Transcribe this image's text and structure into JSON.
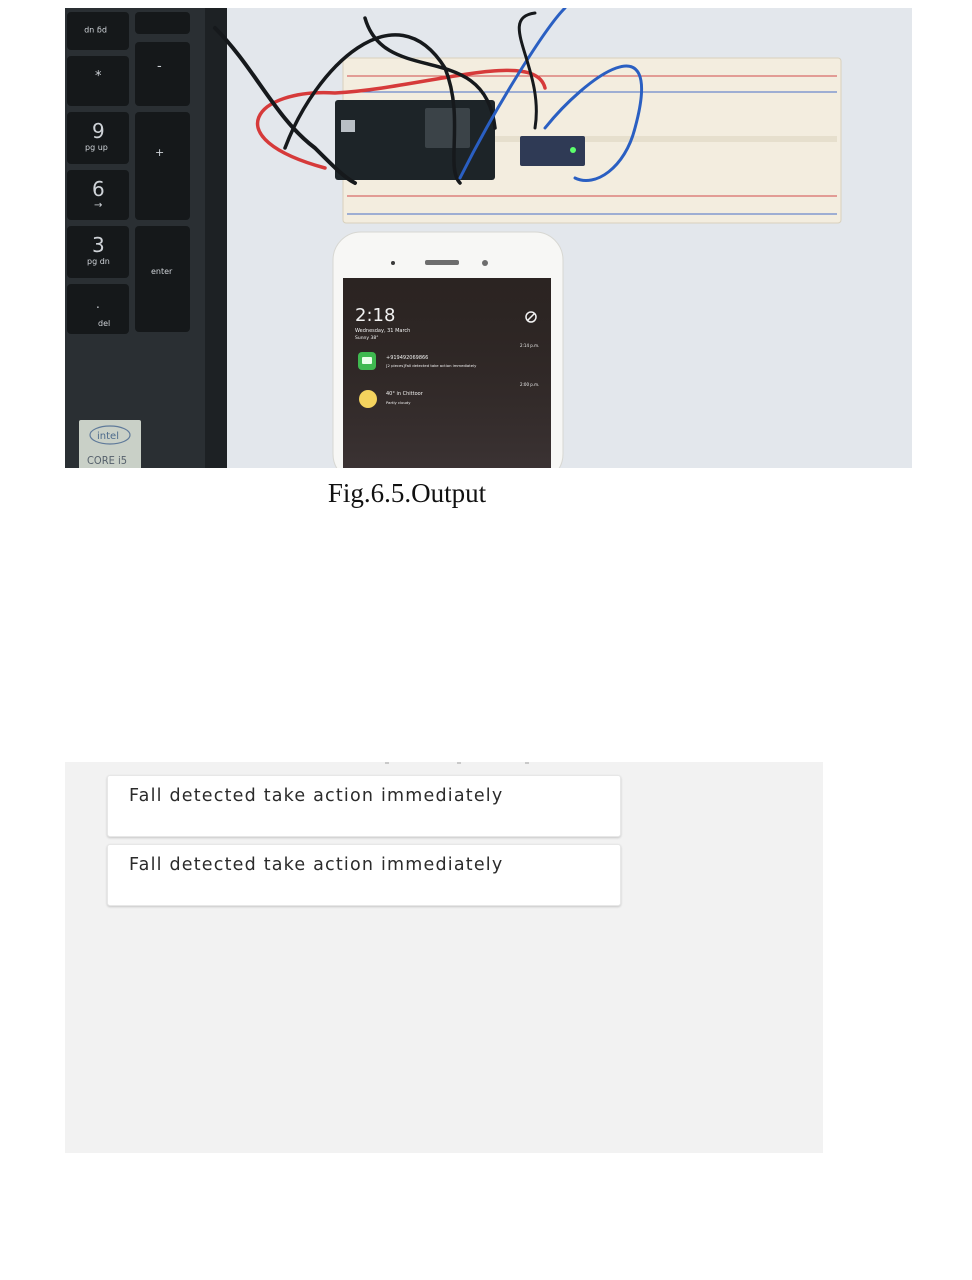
{
  "figure": {
    "caption": "Fig.6.5.Output",
    "photo": {
      "keyboard_keys": [
        "pg up",
        "*",
        "-",
        "9",
        "pg up",
        "+",
        "6",
        "→",
        "3",
        "pg dn",
        "enter",
        ".",
        "del"
      ],
      "laptop_sticker": {
        "brand": "intel",
        "model": "CORE i5"
      },
      "phone": {
        "time": "2:18",
        "date": "Wednesday, 31 March",
        "weather_line": "Sunny 38°",
        "dnd_icon": "do-not-disturb-icon",
        "notifications": [
          {
            "sender": "+919492069866",
            "preview": "[2 pieces]Fall detected take action immediately",
            "time": "2:14 p.m.",
            "icon": "message-icon",
            "icon_color": "#3fb950"
          },
          {
            "sender": "40° in Chittoor",
            "preview": "Partly cloudy",
            "time": "2:00 p.m.",
            "icon": "weather-icon",
            "icon_color": "#f4d35e"
          }
        ]
      }
    }
  },
  "sms_screenshot": {
    "messages": [
      {
        "text": "Fall detected take action immediately"
      },
      {
        "text": "Fall detected take action immediately"
      }
    ]
  }
}
